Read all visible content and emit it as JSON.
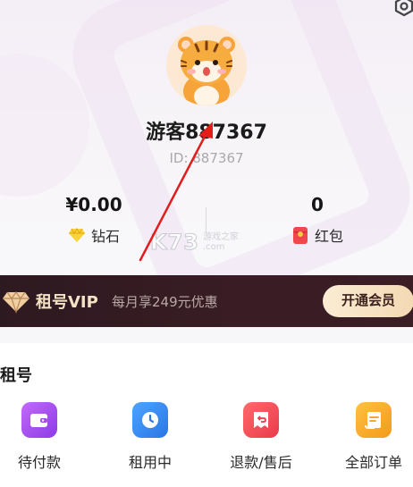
{
  "profile": {
    "username": "游客887367",
    "user_id": "ID: 887367"
  },
  "stats": {
    "diamonds": {
      "value": "¥0.00",
      "label": "钻石",
      "icon": "gem-icon"
    },
    "red_packets": {
      "value": "0",
      "label": "红包",
      "icon": "red-packet-icon"
    }
  },
  "watermark": {
    "main": "K73",
    "line1": "游戏之家",
    "line2": ".com"
  },
  "vip": {
    "title": "租号VIP",
    "description": "每月享249元优惠",
    "button_label": "开通会员"
  },
  "rent_section": {
    "title": "租号",
    "entries": [
      {
        "label": "待付款",
        "icon": "wallet-icon",
        "color": "#a84bf0"
      },
      {
        "label": "租用中",
        "icon": "clock-icon",
        "color": "#3a8ff5"
      },
      {
        "label": "退款/售后",
        "icon": "refund-icon",
        "color": "#f4525a"
      },
      {
        "label": "全部订单",
        "icon": "orders-icon",
        "color": "#f5a623"
      }
    ]
  },
  "colors": {
    "vip_bar": "#351b22",
    "vip_gold": "#f5e3c7",
    "annotation_arrow": "#e21d1d"
  }
}
